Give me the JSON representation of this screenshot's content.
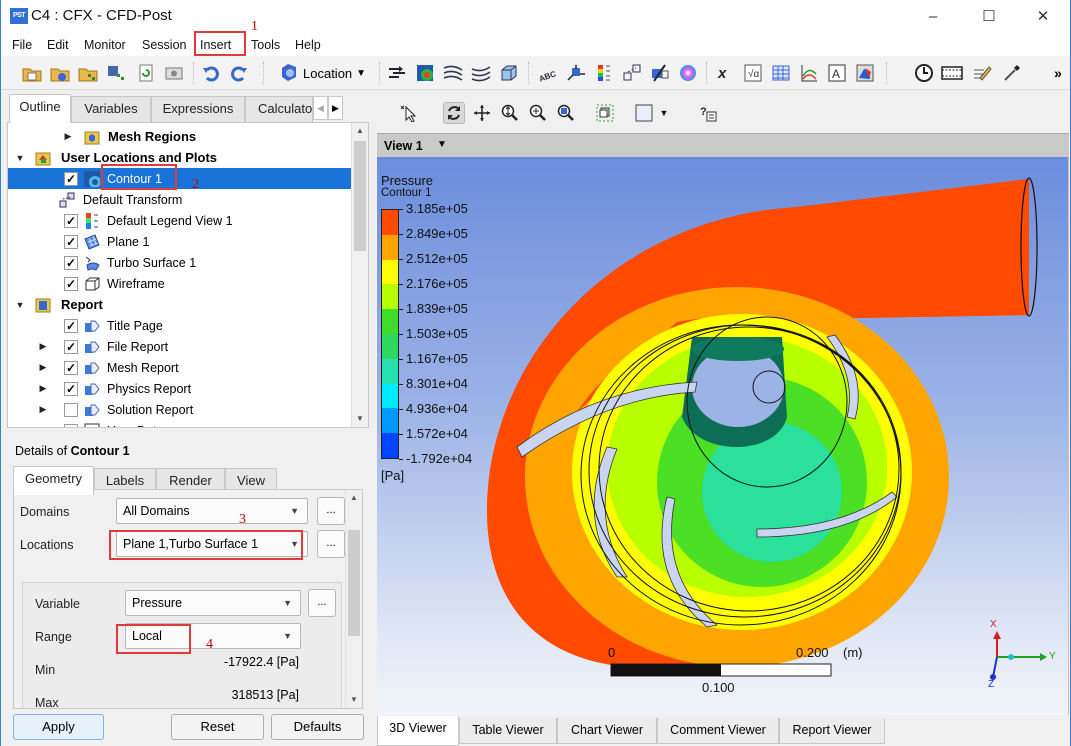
{
  "window": {
    "app_badge": "PST",
    "title": "C4 : CFX - CFD-Post",
    "minimize": "–",
    "maximize": "☐",
    "close": "✕"
  },
  "menu": [
    "File",
    "Edit",
    "Monitor",
    "Session",
    "Insert",
    "Tools",
    "Help"
  ],
  "annotations": {
    "a1": "1",
    "a2": "2",
    "a3": "3",
    "a4": "4"
  },
  "toolbar": {
    "location_label": "Location",
    "overflow": "»",
    "icons": [
      "load-state-icon",
      "save-state-icon",
      "load-results-icon",
      "save-project-icon",
      "refresh-icon",
      "screenshot-icon",
      "undo-icon",
      "redo-icon",
      "location-icon",
      "vector-icon",
      "contour-icon",
      "streamline-icon",
      "particle-track-icon",
      "volume-rendering-icon",
      "text-icon",
      "coordinate-frame-icon",
      "legend-icon",
      "instance-transform-icon",
      "clip-plane-icon",
      "color-map-icon",
      "variable-icon",
      "expression-icon",
      "table-icon",
      "chart-icon",
      "comment-icon",
      "figure-icon",
      "timestep-icon",
      "animation-icon",
      "quick-editor-icon",
      "probe-icon"
    ]
  },
  "outline": {
    "tabs": [
      "Outline",
      "Variables",
      "Expressions",
      "Calculato"
    ],
    "active_tab": "Outline",
    "tree": [
      {
        "label": "Mesh Regions",
        "bold": true,
        "expander": "collapsed",
        "checked": null,
        "icon": "mesh-regions-icon"
      },
      {
        "label": "User Locations and Plots",
        "bold": true,
        "expander": "expanded",
        "checked": null,
        "icon": "user-locations-icon"
      },
      {
        "label": "Contour 1",
        "bold": false,
        "expander": null,
        "checked": true,
        "icon": "contour-icon",
        "selected": true
      },
      {
        "label": "Default Transform",
        "bold": false,
        "expander": null,
        "checked": null,
        "icon": "transform-icon"
      },
      {
        "label": "Default Legend View 1",
        "bold": false,
        "expander": null,
        "checked": true,
        "icon": "legend-icon"
      },
      {
        "label": "Plane 1",
        "bold": false,
        "expander": null,
        "checked": true,
        "icon": "plane-icon"
      },
      {
        "label": "Turbo Surface 1",
        "bold": false,
        "expander": null,
        "checked": true,
        "icon": "turbo-surface-icon"
      },
      {
        "label": "Wireframe",
        "bold": false,
        "expander": null,
        "checked": true,
        "icon": "wireframe-icon"
      },
      {
        "label": "Report",
        "bold": true,
        "expander": "expanded",
        "checked": null,
        "icon": "report-icon"
      },
      {
        "label": "Title Page",
        "bold": false,
        "expander": null,
        "checked": true,
        "icon": "report-item-icon"
      },
      {
        "label": "File Report",
        "bold": false,
        "expander": "collapsed",
        "checked": true,
        "icon": "report-item-icon"
      },
      {
        "label": "Mesh Report",
        "bold": false,
        "expander": "collapsed",
        "checked": true,
        "icon": "report-item-icon"
      },
      {
        "label": "Physics Report",
        "bold": false,
        "expander": "collapsed",
        "checked": true,
        "icon": "report-item-icon"
      },
      {
        "label": "Solution Report",
        "bold": false,
        "expander": "collapsed",
        "checked": false,
        "icon": "report-item-icon"
      },
      {
        "label": "User Data",
        "bold": false,
        "expander": null,
        "checked": true,
        "icon": "user-data-icon"
      }
    ]
  },
  "details": {
    "title_prefix": "Details of ",
    "title_object": "Contour 1",
    "tabs": [
      "Geometry",
      "Labels",
      "Render",
      "View"
    ],
    "active_tab": "Geometry",
    "fields": {
      "domains_label": "Domains",
      "domains_value": "All Domains",
      "locations_label": "Locations",
      "locations_value": "Plane 1,Turbo Surface 1",
      "variable_label": "Variable",
      "variable_value": "Pressure",
      "range_label": "Range",
      "range_value": "Local",
      "min_label": "Min",
      "min_value": "-17922.4 [Pa]",
      "max_label": "Max",
      "max_value": "318513 [Pa]",
      "more_button": "..."
    },
    "buttons": {
      "apply": "Apply",
      "reset": "Reset",
      "defaults": "Defaults"
    }
  },
  "viewer": {
    "view_name": "View 1",
    "legend": {
      "title": "Pressure",
      "subtitle": "Contour 1",
      "unit": "[Pa]",
      "ticks": [
        "3.185e+05",
        "2.849e+05",
        "2.512e+05",
        "2.176e+05",
        "1.839e+05",
        "1.503e+05",
        "1.167e+05",
        "8.301e+04",
        "4.936e+04",
        "1.572e+04",
        "-1.792e+04"
      ],
      "colors": [
        "#ff4a00",
        "#ffa500",
        "#ffff00",
        "#b8ff00",
        "#3fdc2a",
        "#2ed860",
        "#26e0b0",
        "#00eaff",
        "#0099ff",
        "#0044ff"
      ]
    },
    "scale": {
      "start": "0",
      "mid": "0.100",
      "end": "0.200",
      "unit": "(m)"
    },
    "axes": {
      "x": "X",
      "y": "Y",
      "z": "Z"
    },
    "bottom_tabs": [
      "3D Viewer",
      "Table Viewer",
      "Chart Viewer",
      "Comment Viewer",
      "Report Viewer"
    ],
    "active_bottom_tab": "3D Viewer"
  }
}
